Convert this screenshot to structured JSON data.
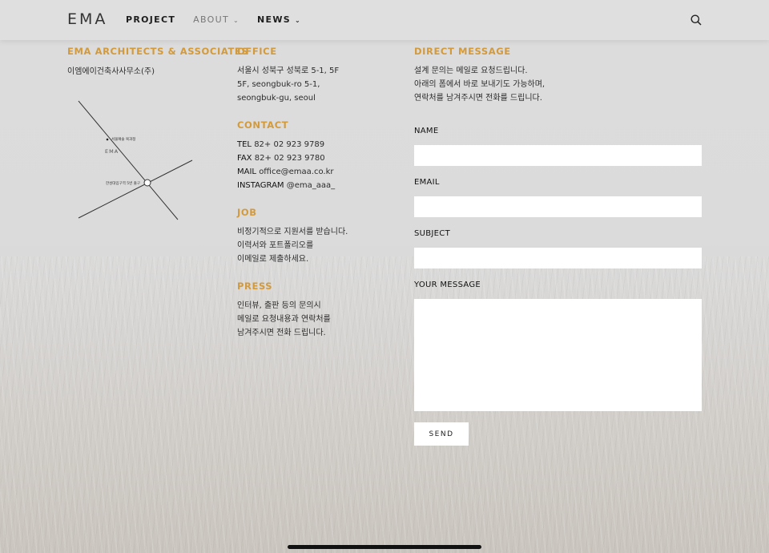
{
  "header": {
    "logo": "EMA",
    "nav": [
      {
        "label": "PROJECT",
        "caret": ""
      },
      {
        "label": "ABOUT",
        "caret": "⌄"
      },
      {
        "label": "NEWS",
        "caret": "⌄"
      }
    ],
    "search_icon": "search-icon"
  },
  "firm": {
    "title": "EMA ARCHITECTS & ASSOCIATES",
    "korean_name": "이엠에이건축사사무소(주)",
    "map": {
      "label_top": "서울예술 복과정",
      "label_ema": "EMA",
      "label_station": "한성대입구역 5번 출구"
    }
  },
  "office": {
    "title": "OFFICE",
    "lines": [
      "서울시 성북구 성북로 5-1, 5F",
      "5F, seongbuk-ro 5-1,",
      "seongbuk-gu, seoul"
    ]
  },
  "contact": {
    "title": "CONTACT",
    "tel_label": "TEL",
    "tel": "82+ 02 923 9789",
    "fax_label": "FAX",
    "fax": "82+ 02 923 9780",
    "mail_label": "MAIL",
    "mail": "office@emaa.co.kr",
    "instagram_label": "INSTAGRAM",
    "instagram": "@ema_aaa_"
  },
  "job": {
    "title": "JOB",
    "lines": [
      "비정기적으로 지원서를 받습니다.",
      "이력서와 포트폴리오를",
      "이메일로 제출하세요."
    ]
  },
  "press": {
    "title": "PRESS",
    "lines": [
      "인터뷰, 출판 등의 문의시",
      "메일로 요청내용과 연락처를",
      "남겨주시면 전화 드립니다."
    ]
  },
  "form": {
    "title": "DIRECT MESSAGE",
    "desc": [
      "설계 문의는 메일로 요청드립니다.",
      "아래의 폼에서 바로 보내기도 가능하며,",
      "연락처를 남겨주시면 전화를 드립니다."
    ],
    "name_label": "NAME",
    "email_label": "EMAIL",
    "subject_label": "SUBJECT",
    "message_label": "YOUR MESSAGE",
    "name_value": "",
    "email_value": "",
    "subject_value": "",
    "message_value": "",
    "send_label": "SEND"
  },
  "colors": {
    "accent": "#d39a3c",
    "background": "#dcdcdc",
    "field": "#ffffff"
  }
}
